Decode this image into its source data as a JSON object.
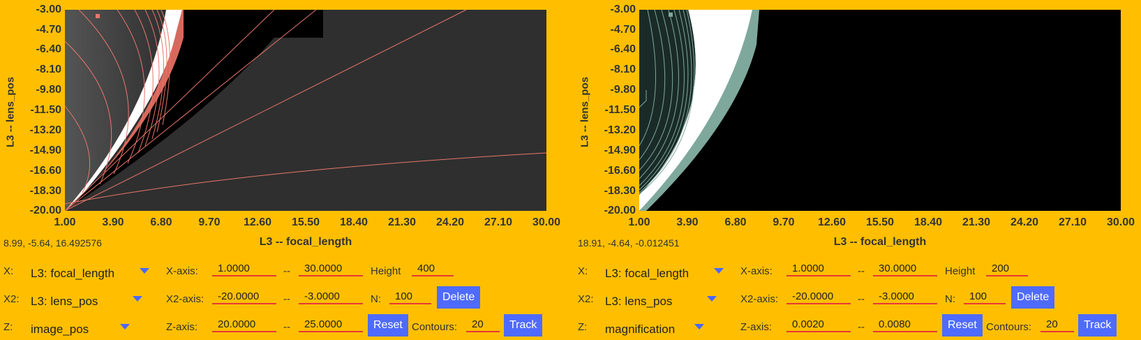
{
  "panels": [
    {
      "y_axis_label": "L3 -- lens_pos",
      "x_axis_label": "L3 -- focal_length",
      "y_ticks": [
        "-3.00",
        "-4.70",
        "-6.40",
        "-8.10",
        "-9.80",
        "-11.50",
        "-13.20",
        "-14.90",
        "-16.60",
        "-18.30",
        "-20.00"
      ],
      "x_ticks": [
        "1.00",
        "3.90",
        "6.80",
        "9.70",
        "12.60",
        "15.50",
        "18.40",
        "21.30",
        "24.20",
        "27.10",
        "30.00"
      ],
      "readout": "8.99, -5.64, 16.492576",
      "contour_color": "#e8776b",
      "controls": {
        "x_label": "X:",
        "x_select": "L3: focal_length",
        "x2_label": "X2:",
        "x2_select": "L3: lens_pos",
        "z_label": "Z:",
        "z_select": "image_pos",
        "xaxis_label": "X-axis:",
        "xaxis_min": "1.0000",
        "xaxis_max": "30.0000",
        "x2axis_label": "X2-axis:",
        "x2axis_min": "-20.0000",
        "x2axis_max": "-3.0000",
        "zaxis_label": "Z-axis:",
        "zaxis_min": "20.0000",
        "zaxis_max": "25.0000",
        "dash": "--",
        "height_label": "Height",
        "height_value": "400",
        "n_label": "N:",
        "n_value": "100",
        "contours_label": "Contours:",
        "contours_value": "20",
        "delete_label": "Delete",
        "reset_label": "Reset",
        "track_label": "Track"
      }
    },
    {
      "y_axis_label": "L3 -- lens_pos",
      "x_axis_label": "L3 -- focal_length",
      "y_ticks": [
        "-3.00",
        "-4.70",
        "-6.40",
        "-8.10",
        "-9.80",
        "-11.50",
        "-13.20",
        "-14.90",
        "-16.60",
        "-18.30",
        "-20.00"
      ],
      "x_ticks": [
        "1.00",
        "3.90",
        "6.80",
        "9.70",
        "12.60",
        "15.50",
        "18.40",
        "21.30",
        "24.20",
        "27.10",
        "30.00"
      ],
      "readout": "18.91, -4.64, -0.012451",
      "contour_color": "#7fa89c",
      "controls": {
        "x_label": "X:",
        "x_select": "L3: focal_length",
        "x2_label": "X2:",
        "x2_select": "L3: lens_pos",
        "z_label": "Z:",
        "z_select": "magnification",
        "xaxis_label": "X-axis:",
        "xaxis_min": "1.0000",
        "xaxis_max": "30.0000",
        "x2axis_label": "X2-axis:",
        "x2axis_min": "-20.0000",
        "x2axis_max": "-3.0000",
        "zaxis_label": "Z-axis:",
        "zaxis_min": "0.0020",
        "zaxis_max": "0.0080",
        "dash": "--",
        "height_label": "Height",
        "height_value": "200",
        "n_label": "N:",
        "n_value": "100",
        "contours_label": "Contours:",
        "contours_value": "20",
        "delete_label": "Delete",
        "reset_label": "Reset",
        "track_label": "Track"
      }
    }
  ]
}
